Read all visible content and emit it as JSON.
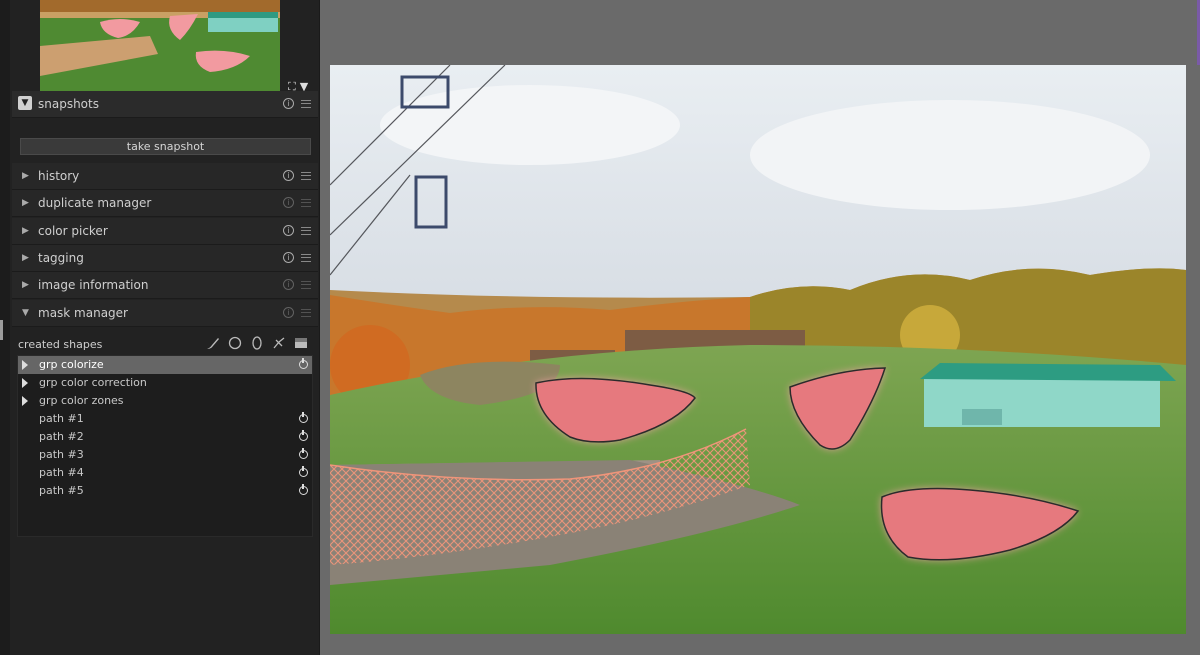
{
  "colors": {
    "panel_bg": "#222222",
    "selected_row": "#666666",
    "mask_fill": "#e6797e",
    "workspace_bg": "#6a6a6a"
  },
  "navigation": {
    "zoom_icon": "fullscreen-icon",
    "dropdown_icon": "caret-down-icon"
  },
  "snapshots": {
    "title": "snapshots",
    "take_snapshot_label": "take snapshot"
  },
  "modules": [
    {
      "label": "history"
    },
    {
      "label": "duplicate manager"
    },
    {
      "label": "color picker"
    },
    {
      "label": "tagging"
    },
    {
      "label": "image information"
    }
  ],
  "mask_manager": {
    "title": "mask manager",
    "created_shapes_label": "created shapes",
    "tools": [
      "brush-icon",
      "circle-icon",
      "ellipse-icon",
      "path-icon",
      "gradient-icon"
    ],
    "groups": [
      "grp colorize",
      "grp color correction",
      "grp color zones"
    ],
    "paths": [
      "path #1",
      "path #2",
      "path #3",
      "path #4",
      "path #5"
    ]
  }
}
